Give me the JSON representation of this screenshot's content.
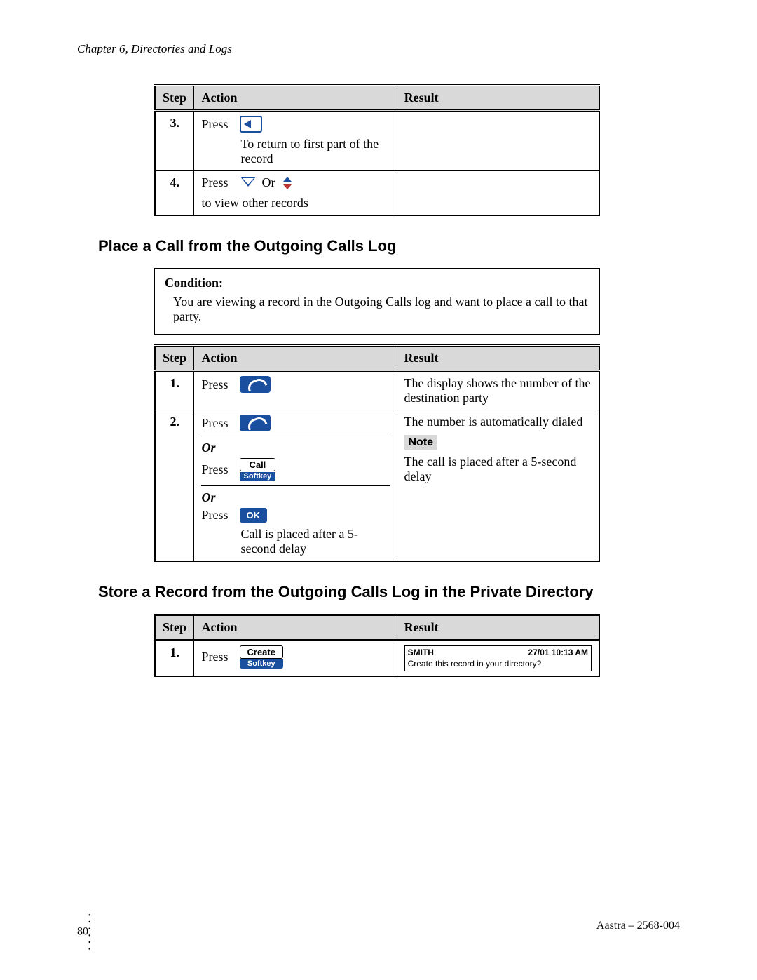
{
  "chapter_header": "Chapter 6, Directories and Logs",
  "labels": {
    "press": "Press",
    "or_caps": "Or",
    "or_italic": "Or",
    "softkey": "Softkey",
    "note": "Note"
  },
  "table1": {
    "headers": {
      "step": "Step",
      "action": "Action",
      "result": "Result"
    },
    "rows": [
      {
        "step": "3.",
        "action_text": "To return to first part of the record",
        "result": ""
      },
      {
        "step": "4.",
        "action_text": "to view other records",
        "result": ""
      }
    ]
  },
  "section1_title": "Place a Call from the Outgoing Calls Log",
  "condition": {
    "label": "Condition:",
    "text": "You are viewing a record in the Outgoing Calls log and want to place a call to that party."
  },
  "table2": {
    "headers": {
      "step": "Step",
      "action": "Action",
      "result": "Result"
    },
    "rows": [
      {
        "step": "1.",
        "result": "The display shows the number of the destination party"
      },
      {
        "step": "2.",
        "softkey_call": "Call",
        "ok_label": "OK",
        "action_tail": "Call is placed after a 5-second delay",
        "result_line1": "The number is automatically dialed",
        "result_note_body": "The call is placed after a 5-second delay"
      }
    ]
  },
  "section2_title": "Store a Record from the Outgoing Calls Log in the Private Directory",
  "table3": {
    "headers": {
      "step": "Step",
      "action": "Action",
      "result": "Result"
    },
    "rows": [
      {
        "step": "1.",
        "softkey_create": "Create",
        "display": {
          "name": "SMITH",
          "datetime": "27/01   10:13 AM",
          "line2": "Create this record in your directory?"
        }
      }
    ]
  },
  "footer": {
    "page": "80",
    "doc": "Aastra – 2568-004"
  }
}
